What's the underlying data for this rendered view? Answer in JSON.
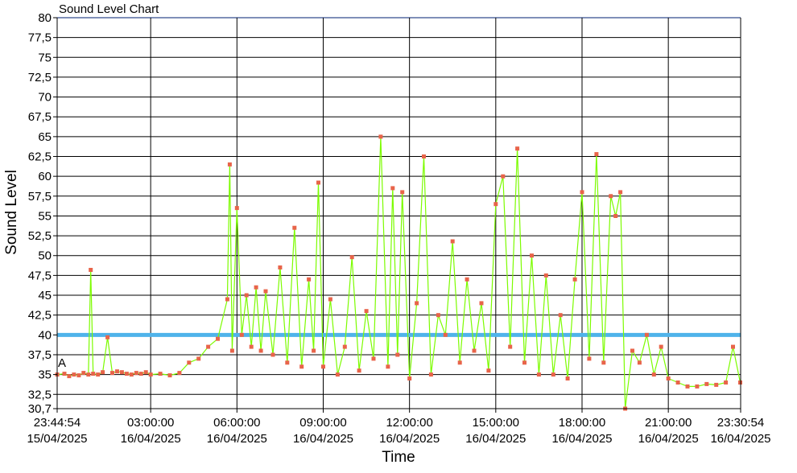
{
  "chart_data": {
    "type": "line",
    "title": "Sound Level Chart",
    "xlabel": "Time",
    "ylabel": "Sound Level",
    "ylim": [
      30.7,
      80
    ],
    "xlim": [
      "15/04/2025 23:44:54",
      "16/04/2025 23:30:54"
    ],
    "yticks": [
      "80",
      "77,5",
      "75",
      "72,5",
      "70",
      "67,5",
      "65",
      "62,5",
      "60",
      "57,5",
      "55",
      "52,5",
      "50",
      "47,5",
      "45",
      "42,5",
      "40",
      "37,5",
      "35",
      "32,5",
      "30,7"
    ],
    "xticks": [
      {
        "time": "23:44:54",
        "date": "15/04/2025"
      },
      {
        "time": "03:00:00",
        "date": "16/04/2025"
      },
      {
        "time": "06:00:00",
        "date": "16/04/2025"
      },
      {
        "time": "09:00:00",
        "date": "16/04/2025"
      },
      {
        "time": "12:00:00",
        "date": "16/04/2025"
      },
      {
        "time": "15:00:00",
        "date": "16/04/2025"
      },
      {
        "time": "18:00:00",
        "date": "16/04/2025"
      },
      {
        "time": "21:00:00",
        "date": "16/04/2025"
      },
      {
        "time": "23:30:54",
        "date": "16/04/2025"
      }
    ],
    "threshold": {
      "value": 40,
      "color": "#4FB3EA"
    },
    "reference_marker": {
      "label": "A",
      "value": 36.5
    },
    "grid": true,
    "colors": {
      "line": "#7CFC00",
      "marker": "#E8644A",
      "grid": "#000000",
      "top_line": "#7F8FB8"
    },
    "series": [
      {
        "x": [
          "2025-04-15 23:45",
          "2025-04-16 00:00",
          "2025-04-16 00:10",
          "2025-04-16 00:20",
          "2025-04-16 00:30",
          "2025-04-16 00:40",
          "2025-04-16 00:50",
          "2025-04-16 00:55",
          "2025-04-16 01:00",
          "2025-04-16 01:10",
          "2025-04-16 01:20",
          "2025-04-16 01:30",
          "2025-04-16 01:40",
          "2025-04-16 01:50",
          "2025-04-16 02:00",
          "2025-04-16 02:10",
          "2025-04-16 02:20",
          "2025-04-16 02:30",
          "2025-04-16 02:40",
          "2025-04-16 02:50",
          "2025-04-16 03:00",
          "2025-04-16 03:20",
          "2025-04-16 03:40",
          "2025-04-16 04:00",
          "2025-04-16 04:20",
          "2025-04-16 04:40",
          "2025-04-16 05:00",
          "2025-04-16 05:20",
          "2025-04-16 05:40",
          "2025-04-16 05:45",
          "2025-04-16 05:50",
          "2025-04-16 06:00",
          "2025-04-16 06:10",
          "2025-04-16 06:20",
          "2025-04-16 06:30",
          "2025-04-16 06:40",
          "2025-04-16 06:50",
          "2025-04-16 07:00",
          "2025-04-16 07:15",
          "2025-04-16 07:30",
          "2025-04-16 07:45",
          "2025-04-16 08:00",
          "2025-04-16 08:15",
          "2025-04-16 08:30",
          "2025-04-16 08:40",
          "2025-04-16 08:50",
          "2025-04-16 09:00",
          "2025-04-16 09:15",
          "2025-04-16 09:30",
          "2025-04-16 09:45",
          "2025-04-16 10:00",
          "2025-04-16 10:15",
          "2025-04-16 10:30",
          "2025-04-16 10:45",
          "2025-04-16 11:00",
          "2025-04-16 11:15",
          "2025-04-16 11:25",
          "2025-04-16 11:35",
          "2025-04-16 11:45",
          "2025-04-16 12:00",
          "2025-04-16 12:15",
          "2025-04-16 12:30",
          "2025-04-16 12:45",
          "2025-04-16 13:00",
          "2025-04-16 13:15",
          "2025-04-16 13:30",
          "2025-04-16 13:45",
          "2025-04-16 14:00",
          "2025-04-16 14:15",
          "2025-04-16 14:30",
          "2025-04-16 14:45",
          "2025-04-16 15:00",
          "2025-04-16 15:15",
          "2025-04-16 15:30",
          "2025-04-16 15:45",
          "2025-04-16 16:00",
          "2025-04-16 16:15",
          "2025-04-16 16:30",
          "2025-04-16 16:45",
          "2025-04-16 17:00",
          "2025-04-16 17:15",
          "2025-04-16 17:30",
          "2025-04-16 17:45",
          "2025-04-16 18:00",
          "2025-04-16 18:15",
          "2025-04-16 18:30",
          "2025-04-16 18:45",
          "2025-04-16 19:00",
          "2025-04-16 19:10",
          "2025-04-16 19:20",
          "2025-04-16 19:30",
          "2025-04-16 19:45",
          "2025-04-16 20:00",
          "2025-04-16 20:15",
          "2025-04-16 20:30",
          "2025-04-16 20:45",
          "2025-04-16 21:00",
          "2025-04-16 21:20",
          "2025-04-16 21:40",
          "2025-04-16 22:00",
          "2025-04-16 22:20",
          "2025-04-16 22:40",
          "2025-04-16 23:00",
          "2025-04-16 23:15",
          "2025-04-16 23:30"
        ],
        "y": [
          35.0,
          35.1,
          34.8,
          35.0,
          34.9,
          35.2,
          35.0,
          48.2,
          35.1,
          35.0,
          35.3,
          39.7,
          35.2,
          35.4,
          35.3,
          35.1,
          35.0,
          35.2,
          35.1,
          35.3,
          35.0,
          35.1,
          34.9,
          35.2,
          36.5,
          37.0,
          38.5,
          39.5,
          44.5,
          61.5,
          38.0,
          56.0,
          40.0,
          45.0,
          38.5,
          46.0,
          38.0,
          45.5,
          37.5,
          48.5,
          36.5,
          53.5,
          36.0,
          47.0,
          38.0,
          59.2,
          36.0,
          44.5,
          35.0,
          38.5,
          49.8,
          35.5,
          43.0,
          37.0,
          65.0,
          36.0,
          58.5,
          37.5,
          58.0,
          34.5,
          44.0,
          62.5,
          35.0,
          42.5,
          40.0,
          51.8,
          36.5,
          47.0,
          38.0,
          44.0,
          35.5,
          56.5,
          60.0,
          38.5,
          63.5,
          36.5,
          50.0,
          35.0,
          47.5,
          35.0,
          42.5,
          34.5,
          47.0,
          58.0,
          37.0,
          62.8,
          36.5,
          57.5,
          55.0,
          58.0,
          30.7,
          38.0,
          36.5,
          40.0,
          35.0,
          38.5,
          34.5,
          34.0,
          33.5,
          33.5,
          33.8,
          33.7,
          34.0,
          38.5,
          34.0
        ]
      }
    ]
  }
}
